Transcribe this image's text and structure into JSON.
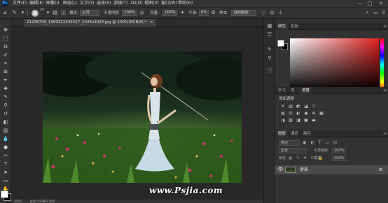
{
  "app": {
    "logo": "Ps"
  },
  "menu": [
    "文件(F)",
    "编辑(E)",
    "图像(I)",
    "图层(L)",
    "文字(Y)",
    "选择(S)",
    "滤镜(T)",
    "3D(D)",
    "视图(V)",
    "窗口(W)",
    "帮助(H)"
  ],
  "window_controls": {
    "minimize": "—",
    "maximize": "□",
    "close": "✕"
  },
  "options_bar": {
    "brush_size": "20",
    "mode_label": "模式:",
    "mode_value": "正常",
    "opacity_label": "不透明度:",
    "opacity_value": "100%",
    "flow_label": "流量:",
    "flow_value": "100%",
    "smoothing_label": "平滑:",
    "smoothing_value": "0%",
    "sample_label": "样本:",
    "sample_value": "当前图层"
  },
  "document": {
    "tab_label": "21238799_1369321334527_1024x1024.jpg @ 100%(RGB/8) *",
    "close": "×"
  },
  "status": {
    "zoom": "100%",
    "info": "文档:3.00M/3.00M"
  },
  "watermark": "www.Psjia.com",
  "color_panel": {
    "tabs": [
      "颜色",
      "色板"
    ]
  },
  "adjust_panel": {
    "tabs": [
      "学习",
      "库",
      "调整"
    ],
    "active_tab": "调整",
    "title": "添加调整"
  },
  "layers_panel": {
    "tabs": [
      "图层",
      "通道",
      "路径"
    ],
    "kind_placeholder": "类型",
    "blend_mode": "正常",
    "opacity_label": "不透明度:",
    "opacity_value": "100%",
    "lock_label": "锁定:",
    "fill_label": "填充:",
    "fill_value": "100%",
    "layers": [
      {
        "name": "背景",
        "visible": true,
        "locked": true
      }
    ]
  },
  "colors": {
    "ui_dark": "#323232",
    "canvas_bg": "#282828",
    "accent": "#31a8ff",
    "foreground": "#ffffff",
    "background": "#000000"
  }
}
